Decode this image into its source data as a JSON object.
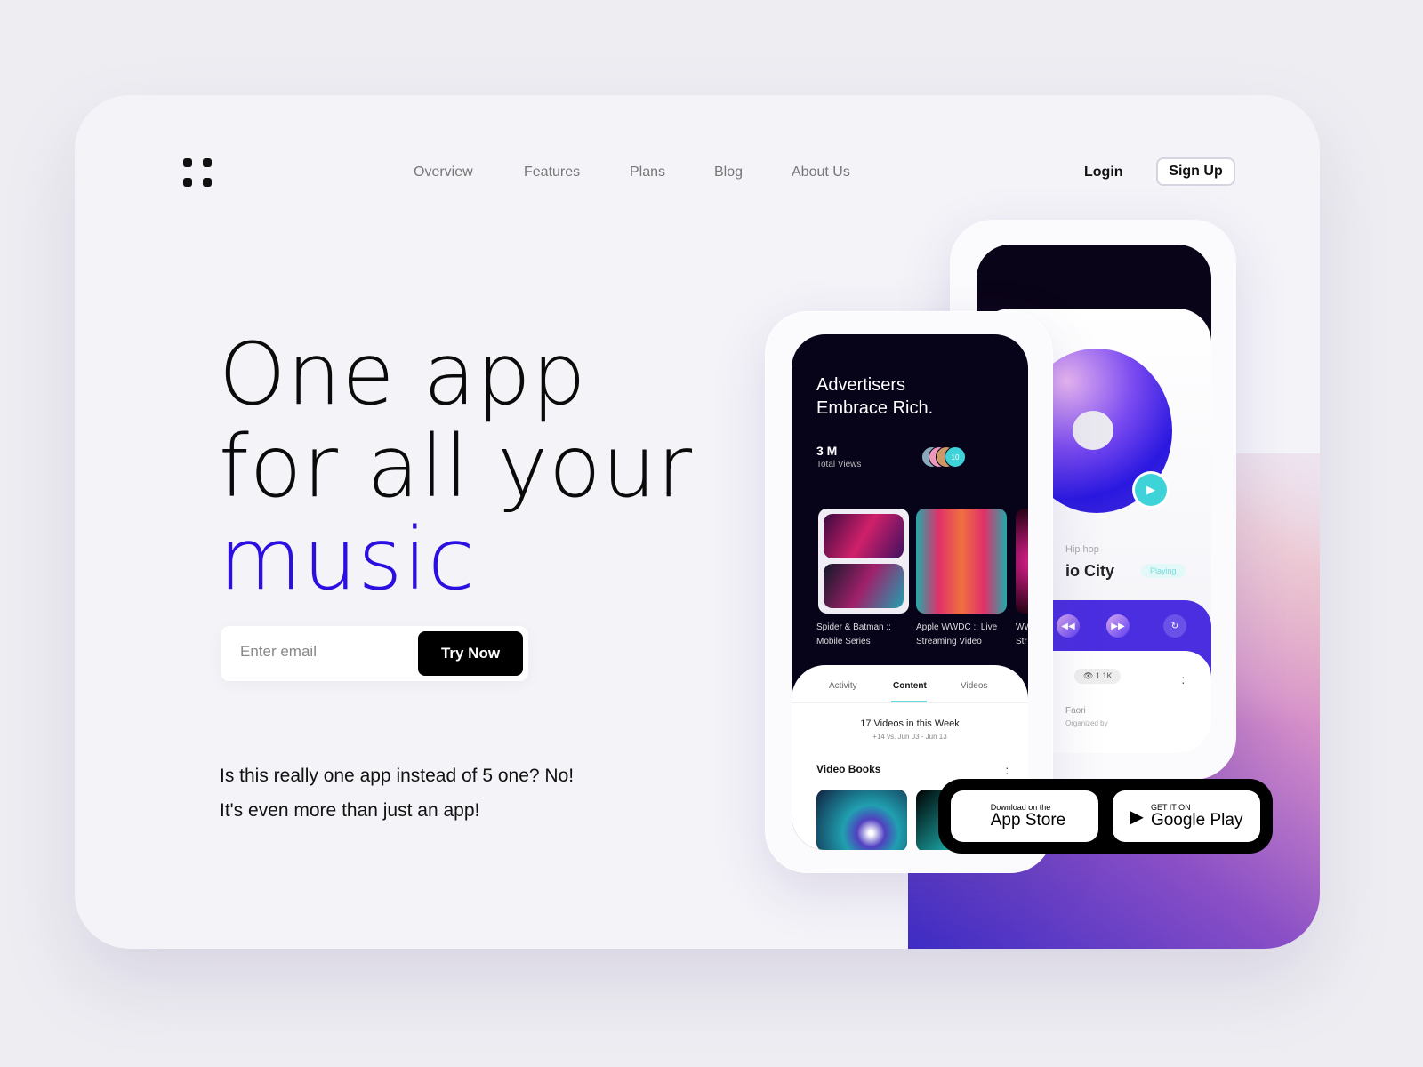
{
  "nav": {
    "items": [
      "Overview",
      "Features",
      "Plans",
      "Blog",
      "About Us"
    ],
    "login": "Login",
    "signup": "Sign Up"
  },
  "hero": {
    "line1": "One app",
    "line2": "for all your",
    "line3": "music"
  },
  "signup_form": {
    "placeholder": "Enter email",
    "button": "Try Now"
  },
  "subtitle": {
    "line1": "Is this really one app instead of 5 one? No!",
    "line2": "It's even more than just an app!"
  },
  "player": {
    "genre": "Hip hop",
    "song": "io City",
    "status": "Playing",
    "views": "1.1K",
    "organizer_name": "Faori",
    "organizer_label": "Organized by"
  },
  "dashboard": {
    "title1": "Advertisers",
    "title2": "Embrace Rich.",
    "stat_value": "3 M",
    "stat_label": "Total Views",
    "avatar_count": "10",
    "cards": [
      {
        "l1": "Spider & Batman ::",
        "l2": "Mobile Series"
      },
      {
        "l1": "Apple WWDC :: Live",
        "l2": "Streaming Video"
      },
      {
        "l1": "WW",
        "l2": "Str"
      }
    ],
    "tabs": [
      "Activity",
      "Content",
      "Videos"
    ],
    "active_tab": "Content",
    "week_title": "17 Videos in this Week",
    "week_sub": "+14 vs. Jun 03 - Jun 13",
    "section": "Video Books"
  },
  "stores": {
    "apple_small": "Download on the",
    "apple_big": "App Store",
    "google_small": "GET IT ON",
    "google_big": "Google Play"
  },
  "colors": {
    "accent": "#2a0fe0",
    "teal": "#3dd3d8",
    "dark": "#07041a"
  }
}
